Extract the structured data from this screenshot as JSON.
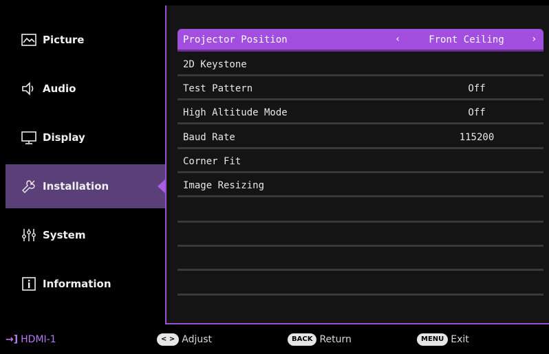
{
  "sidebar": {
    "items": [
      {
        "label": "Picture",
        "icon": "picture-icon"
      },
      {
        "label": "Audio",
        "icon": "speaker-icon"
      },
      {
        "label": "Display",
        "icon": "monitor-icon"
      },
      {
        "label": "Installation",
        "icon": "wrench-icon"
      },
      {
        "label": "System",
        "icon": "sliders-icon"
      },
      {
        "label": "Information",
        "icon": "info-icon"
      }
    ],
    "active": "Installation"
  },
  "menu": {
    "rows": [
      {
        "label": "Projector Position",
        "value": "Front Ceiling"
      },
      {
        "label": "2D Keystone",
        "value": ""
      },
      {
        "label": "Test Pattern",
        "value": "Off"
      },
      {
        "label": "High Altitude Mode",
        "value": "Off"
      },
      {
        "label": "Baud Rate",
        "value": "115200"
      },
      {
        "label": "Corner Fit",
        "value": ""
      },
      {
        "label": "Image Resizing",
        "value": ""
      },
      {
        "label": "",
        "value": ""
      },
      {
        "label": "",
        "value": ""
      },
      {
        "label": "",
        "value": ""
      },
      {
        "label": "",
        "value": ""
      }
    ],
    "arrow_left": "‹",
    "arrow_right": "›"
  },
  "status": {
    "source_icon": "→]",
    "source": "HDMI-1",
    "adjust_key": "< >",
    "adjust_label": "Adjust",
    "back_key": "BACK",
    "back_label": "Return",
    "menu_key": "MENU",
    "menu_label": "Exit"
  },
  "colors": {
    "accent": "#a24fe0",
    "active_sidebar": "#5a3f78",
    "panel": "#141414",
    "source_text": "#b77bf0"
  }
}
